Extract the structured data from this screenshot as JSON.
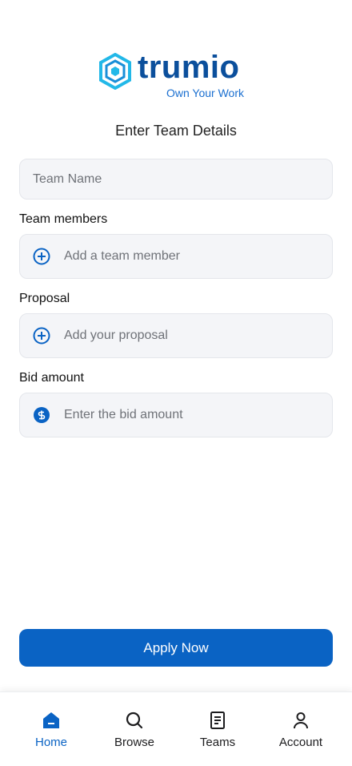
{
  "brand": {
    "name": "trumio",
    "tagline": "Own Your Work",
    "color": "#0b4f9c",
    "accent": "#22b8e8"
  },
  "page": {
    "title": "Enter Team Details"
  },
  "form": {
    "team_name": {
      "placeholder": "Team Name",
      "value": ""
    },
    "members": {
      "label": "Team members",
      "placeholder": "Add a team member",
      "icon": "plus-circle-icon"
    },
    "proposal": {
      "label": "Proposal",
      "placeholder": "Add your proposal",
      "icon": "plus-circle-icon"
    },
    "bid": {
      "label": "Bid amount",
      "placeholder": "Enter the bid amount",
      "icon": "dollar-circle-icon"
    }
  },
  "actions": {
    "apply_label": "Apply Now",
    "primary_color": "#0a63c4"
  },
  "tabbar": {
    "items": [
      {
        "label": "Home",
        "icon": "home-icon",
        "active": true
      },
      {
        "label": "Browse",
        "icon": "search-icon",
        "active": false
      },
      {
        "label": "Teams",
        "icon": "document-icon",
        "active": false
      },
      {
        "label": "Account",
        "icon": "user-icon",
        "active": false
      }
    ]
  }
}
